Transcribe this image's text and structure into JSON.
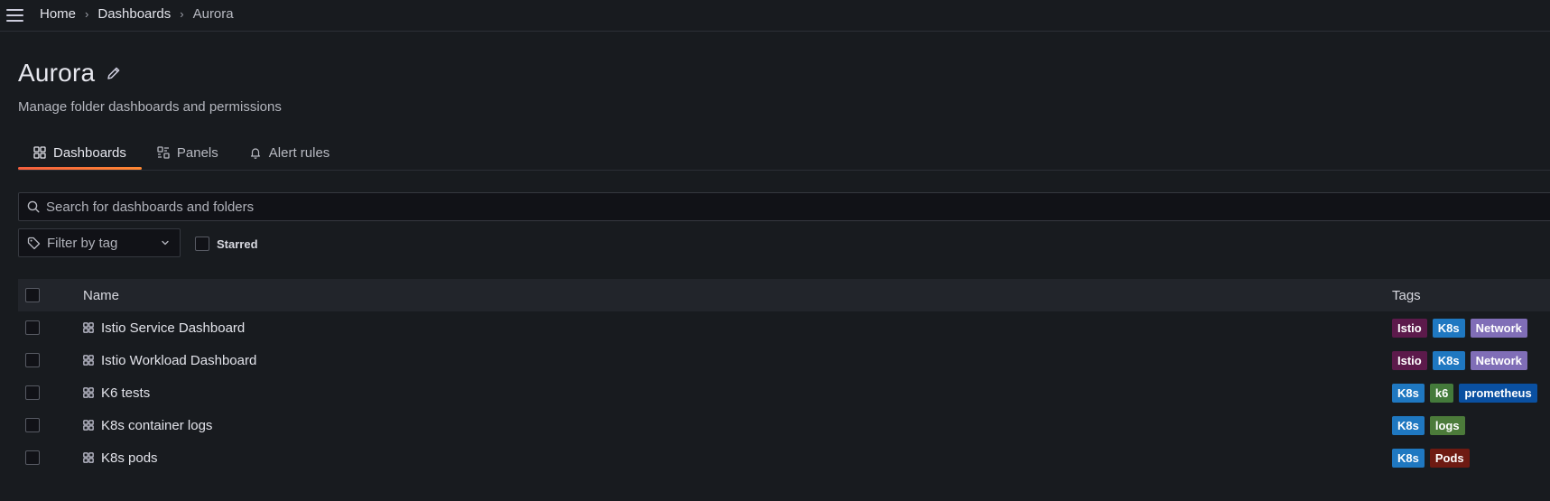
{
  "breadcrumb": {
    "home": "Home",
    "dashboards": "Dashboards",
    "current": "Aurora"
  },
  "header": {
    "title": "Aurora",
    "subtitle": "Manage folder dashboards and permissions"
  },
  "tabs": [
    {
      "label": "Dashboards",
      "icon": "apps-icon",
      "active": true
    },
    {
      "label": "Panels",
      "icon": "library-panel-icon",
      "active": false
    },
    {
      "label": "Alert rules",
      "icon": "bell-icon",
      "active": false
    }
  ],
  "search": {
    "placeholder": "Search for dashboards and folders",
    "value": ""
  },
  "filters": {
    "tag_placeholder": "Filter by tag",
    "starred_label": "Starred",
    "starred_checked": false
  },
  "table": {
    "headers": {
      "name": "Name",
      "tags": "Tags"
    },
    "rows": [
      {
        "name": "Istio Service Dashboard",
        "tags": [
          "Istio",
          "K8s",
          "Network"
        ]
      },
      {
        "name": "Istio Workload Dashboard",
        "tags": [
          "Istio",
          "K8s",
          "Network"
        ]
      },
      {
        "name": "K6 tests",
        "tags": [
          "K8s",
          "k6",
          "prometheus"
        ]
      },
      {
        "name": "K8s container logs",
        "tags": [
          "K8s",
          "logs"
        ]
      },
      {
        "name": "K8s pods",
        "tags": [
          "K8s",
          "Pods"
        ]
      }
    ]
  },
  "tag_colors": {
    "Istio": "#5c1a4b",
    "K8s": "#1f78c1",
    "Network": "#806eb7",
    "k6": "#447a3b",
    "prometheus": "#0a50a1",
    "logs": "#4c7b3a",
    "Pods": "#6e1a12"
  },
  "colors": {
    "background": "#181b1f",
    "accent_start": "#f55f3e",
    "accent_end": "#ff8833"
  }
}
